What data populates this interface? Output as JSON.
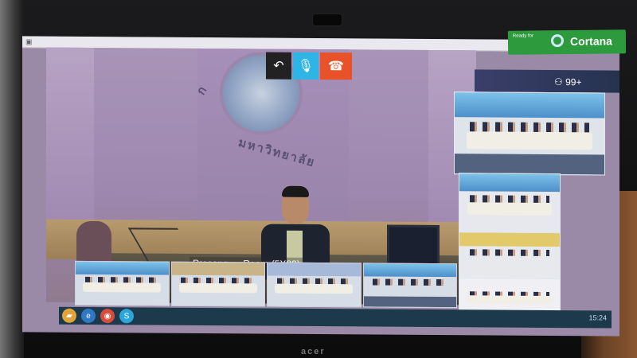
{
  "window": {
    "title_icon": "app-icon",
    "minimize": "—",
    "restore": "❐",
    "close": "✕"
  },
  "call_controls": [
    {
      "name": "undo-arrow-icon",
      "glyph": "↶"
    },
    {
      "name": "mute-mic-icon",
      "glyph": "🎙"
    },
    {
      "name": "hang-up-icon",
      "glyph": "☎"
    }
  ],
  "notifications": {
    "count": "99+"
  },
  "cortana": {
    "tagline": "Ready for",
    "name": "Cortana"
  },
  "main_video": {
    "room_label": "Prasong … Room (5X80)",
    "emblem_text_left": "ก",
    "emblem_text_bottom": "มหาวิทยาลัย"
  },
  "laptop": {
    "brand": "acer"
  },
  "colors": {
    "hangup": "#e8522a",
    "mic": "#2fb4e6",
    "cortana": "#2e9a3e",
    "close": "#d9342b"
  },
  "taskbar": {
    "apps": [
      "folder-icon",
      "ie-icon",
      "chrome-icon",
      "skype-icon"
    ],
    "tray_time": "15:24"
  }
}
